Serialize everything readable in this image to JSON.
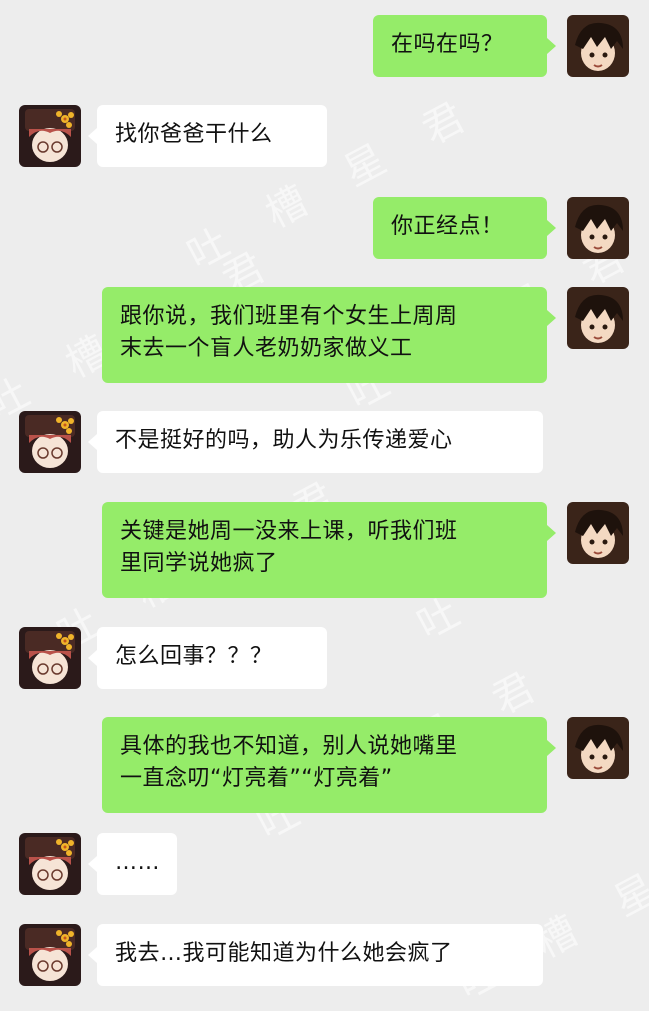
{
  "watermark": "吐 槽 星 君",
  "colors": {
    "background": "#ededed",
    "sent_bubble": "#95ec69",
    "received_bubble": "#ffffff"
  },
  "messages": [
    {
      "side": "sent",
      "text": "在吗在吗？"
    },
    {
      "side": "received",
      "text": "找你爸爸干什么"
    },
    {
      "side": "sent",
      "text": "你正经点！"
    },
    {
      "side": "sent",
      "text": "跟你说，我们班里有个女生上周周\n末去一个盲人老奶奶家做义工"
    },
    {
      "side": "received",
      "text": "不是挺好的吗，助人为乐传递爱心"
    },
    {
      "side": "sent",
      "text": "关键是她周一没来上课，听我们班\n里同学说她疯了"
    },
    {
      "side": "received",
      "text": "怎么回事？？？"
    },
    {
      "side": "sent",
      "text": "具体的我也不知道，别人说她嘴里\n一直念叨“灯亮着”“灯亮着”"
    },
    {
      "side": "received",
      "text": "……"
    },
    {
      "side": "received",
      "text": "我去…我可能知道为什么她会疯了"
    }
  ]
}
